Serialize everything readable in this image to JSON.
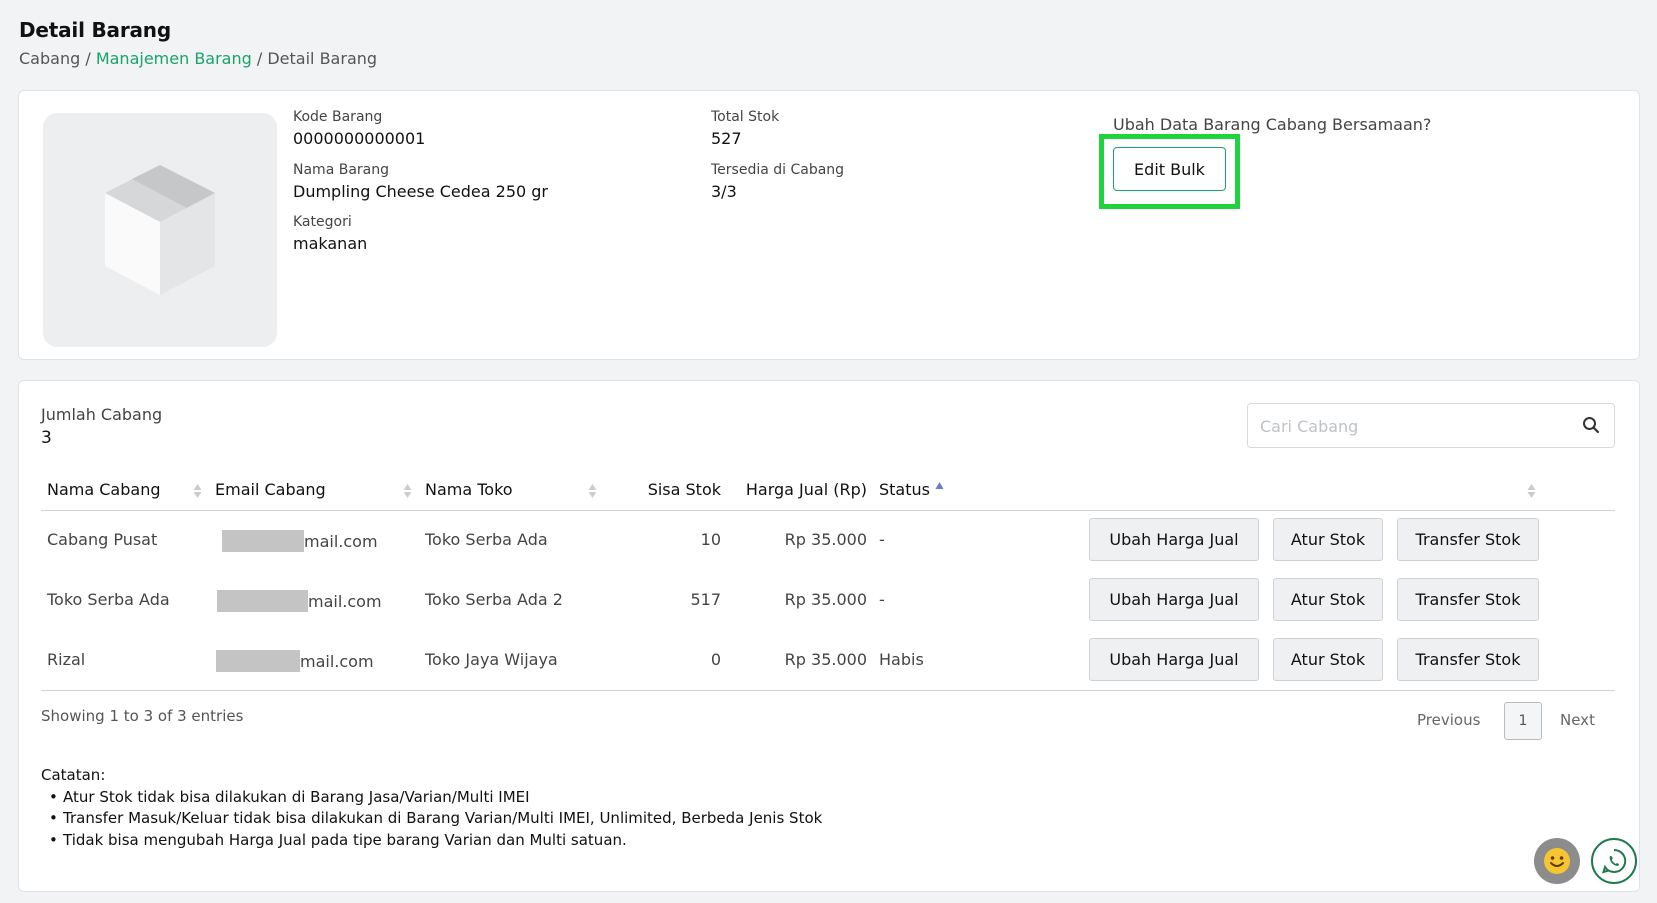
{
  "page": {
    "title": "Detail Barang",
    "breadcrumb": [
      "Cabang",
      "Manajemen Barang",
      "Detail Barang"
    ],
    "breadcrumb_sep": "/"
  },
  "product": {
    "image_icon": "box-placeholder-icon",
    "fields": {
      "code_label": "Kode Barang",
      "code_value": "0000000000001",
      "name_label": "Nama Barang",
      "name_value": "Dumpling Cheese Cedea 250 gr",
      "category_label": "Kategori",
      "category_value": "makanan",
      "total_stock_label": "Total Stok",
      "total_stock_value": "527",
      "available_label": "Tersedia di Cabang",
      "available_value": "3/3"
    },
    "bulk_question": "Ubah Data Barang Cabang Bersamaan?",
    "bulk_button": "Edit Bulk",
    "highlight_color": "#1ed33c"
  },
  "branches": {
    "count_label": "Jumlah Cabang",
    "count_value": "3",
    "search_placeholder": "Cari Cabang",
    "columns": [
      "Nama Cabang",
      "Email Cabang",
      "Nama Toko",
      "Sisa Stok",
      "Harga Jual (Rp)",
      "Status"
    ],
    "rows": [
      {
        "name": "Cabang Pusat",
        "email_suffix": "mail.com",
        "store": "Toko Serba Ada",
        "stock": "10",
        "price": "Rp 35.000",
        "status": "-"
      },
      {
        "name": "Toko Serba Ada",
        "email_suffix": "mail.com",
        "store": "Toko Serba Ada 2",
        "stock": "517",
        "price": "Rp 35.000",
        "status": "-"
      },
      {
        "name": "Rizal",
        "email_suffix": "mail.com",
        "store": "Toko Jaya Wijaya",
        "stock": "0",
        "price": "Rp 35.000",
        "status": "Habis"
      }
    ],
    "actions": [
      "Ubah Harga Jual",
      "Atur Stok",
      "Transfer Stok"
    ],
    "showing": "Showing 1 to 3 of 3 entries",
    "pager": {
      "prev": "Previous",
      "page": "1",
      "next": "Next"
    }
  },
  "notes": {
    "title": "Catatan:",
    "items": [
      "Atur Stok tidak bisa dilakukan di Barang Jasa/Varian/Multi IMEI",
      "Transfer Masuk/Keluar tidak bisa dilakukan di Barang Varian/Multi IMEI, Unlimited, Berbeda Jenis Stok",
      "Tidak bisa mengubah Harga Jual pada tipe barang Varian dan Multi satuan."
    ]
  },
  "colors": {
    "accent": "#1aa36a",
    "background": "#f1f3f5"
  },
  "floating": {
    "left_icon": "smiley-icon",
    "right_icon": "whatsapp-icon"
  }
}
